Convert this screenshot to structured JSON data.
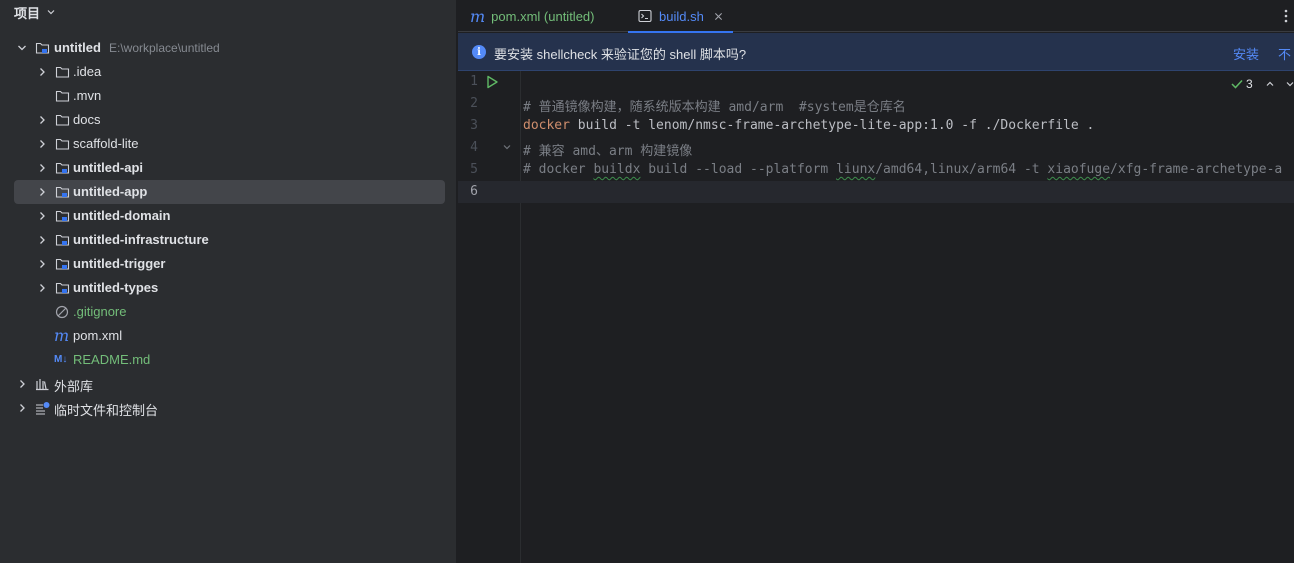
{
  "project_panel": {
    "title": "项目",
    "root": {
      "name": "untitled",
      "path": "E:\\workplace\\untitled"
    },
    "items": [
      {
        "label": ".idea",
        "kind": "folder",
        "expandable": true,
        "bold": false,
        "color": "default"
      },
      {
        "label": ".mvn",
        "kind": "folder",
        "expandable": false,
        "bold": false,
        "color": "default"
      },
      {
        "label": "docs",
        "kind": "folder",
        "expandable": true,
        "bold": false,
        "color": "default"
      },
      {
        "label": "scaffold-lite",
        "kind": "folder",
        "expandable": true,
        "bold": false,
        "color": "default"
      },
      {
        "label": "untitled-api",
        "kind": "module",
        "expandable": true,
        "bold": true,
        "color": "default"
      },
      {
        "label": "untitled-app",
        "kind": "module",
        "expandable": true,
        "bold": true,
        "color": "default",
        "selected": true
      },
      {
        "label": "untitled-domain",
        "kind": "module",
        "expandable": true,
        "bold": true,
        "color": "default"
      },
      {
        "label": "untitled-infrastructure",
        "kind": "module",
        "expandable": true,
        "bold": true,
        "color": "default"
      },
      {
        "label": "untitled-trigger",
        "kind": "module",
        "expandable": true,
        "bold": true,
        "color": "default"
      },
      {
        "label": "untitled-types",
        "kind": "module",
        "expandable": true,
        "bold": true,
        "color": "default"
      },
      {
        "label": ".gitignore",
        "kind": "ignore-file",
        "expandable": false,
        "bold": false,
        "color": "green"
      },
      {
        "label": "pom.xml",
        "kind": "maven-file",
        "expandable": false,
        "bold": false,
        "color": "default"
      },
      {
        "label": "README.md",
        "kind": "markdown-file",
        "expandable": false,
        "bold": false,
        "color": "green"
      }
    ],
    "external_libraries": "外部库",
    "scratches": "临时文件和控制台"
  },
  "editor": {
    "tabs": [
      {
        "label": "pom.xml (untitled)",
        "icon": "maven-icon",
        "active": false
      },
      {
        "label": "build.sh",
        "icon": "shell-script-icon",
        "active": true
      }
    ],
    "banner": {
      "text": "要安装 shellcheck 来验证您的 shell 脚本吗?",
      "install": "安装",
      "dismiss": "不"
    },
    "inspection_count": "3",
    "line_numbers": [
      "1",
      "2",
      "3",
      "4",
      "5",
      "6"
    ],
    "code_lines": [
      "",
      "# 普通镜像构建，随系统版本构建 amd/arm  #system是仓库名",
      "docker build -t lenom/nmsc-frame-archetype-lite-app:1.0 -f ./Dockerfile .",
      "# 兼容 amd、arm 构建镜像",
      "# docker buildx build --load --platform liunx/amd64,linux/arm64 -t xiaofuge/xfg-frame-archetype-a",
      ""
    ],
    "code_tokens": {
      "docker_kw": "docker",
      "build_rest": " build -t lenom/nmsc-frame-archetype-lite-app:1.0 -f ./Dockerfile .",
      "l5_a": "# docker ",
      "l5_b": "buildx",
      "l5_c": " build --load --platform ",
      "l5_d": "liunx",
      "l5_e": "/amd64,linux/arm64 -t ",
      "l5_f": "xiaofuge",
      "l5_g": "/xfg-frame-archetype-a"
    },
    "current_line": 6
  },
  "colors": {
    "accent": "#3574f0",
    "green_text": "#73bd79",
    "comment": "#7a7e85",
    "keyword": "#cf8e6d",
    "link": "#548af7"
  }
}
